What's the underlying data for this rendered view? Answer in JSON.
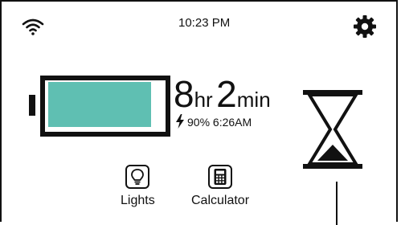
{
  "status": {
    "time": "10:23 PM",
    "wifi_icon": "wifi-icon",
    "settings_icon": "gear-icon"
  },
  "battery": {
    "level_percent": 90,
    "fill_color": "#5fbfb2",
    "runtime_hours": "8",
    "runtime_hours_unit": "hr",
    "runtime_minutes": "2",
    "runtime_minutes_unit": "min",
    "charge_percent_text": "90%",
    "full_time_text": "6:26AM",
    "charging_icon": "lightning-bolt-icon"
  },
  "timer": {
    "icon": "hourglass-icon"
  },
  "apps": [
    {
      "label": "Lights",
      "icon": "lightbulb-icon"
    },
    {
      "label": "Calculator",
      "icon": "calculator-icon"
    }
  ]
}
